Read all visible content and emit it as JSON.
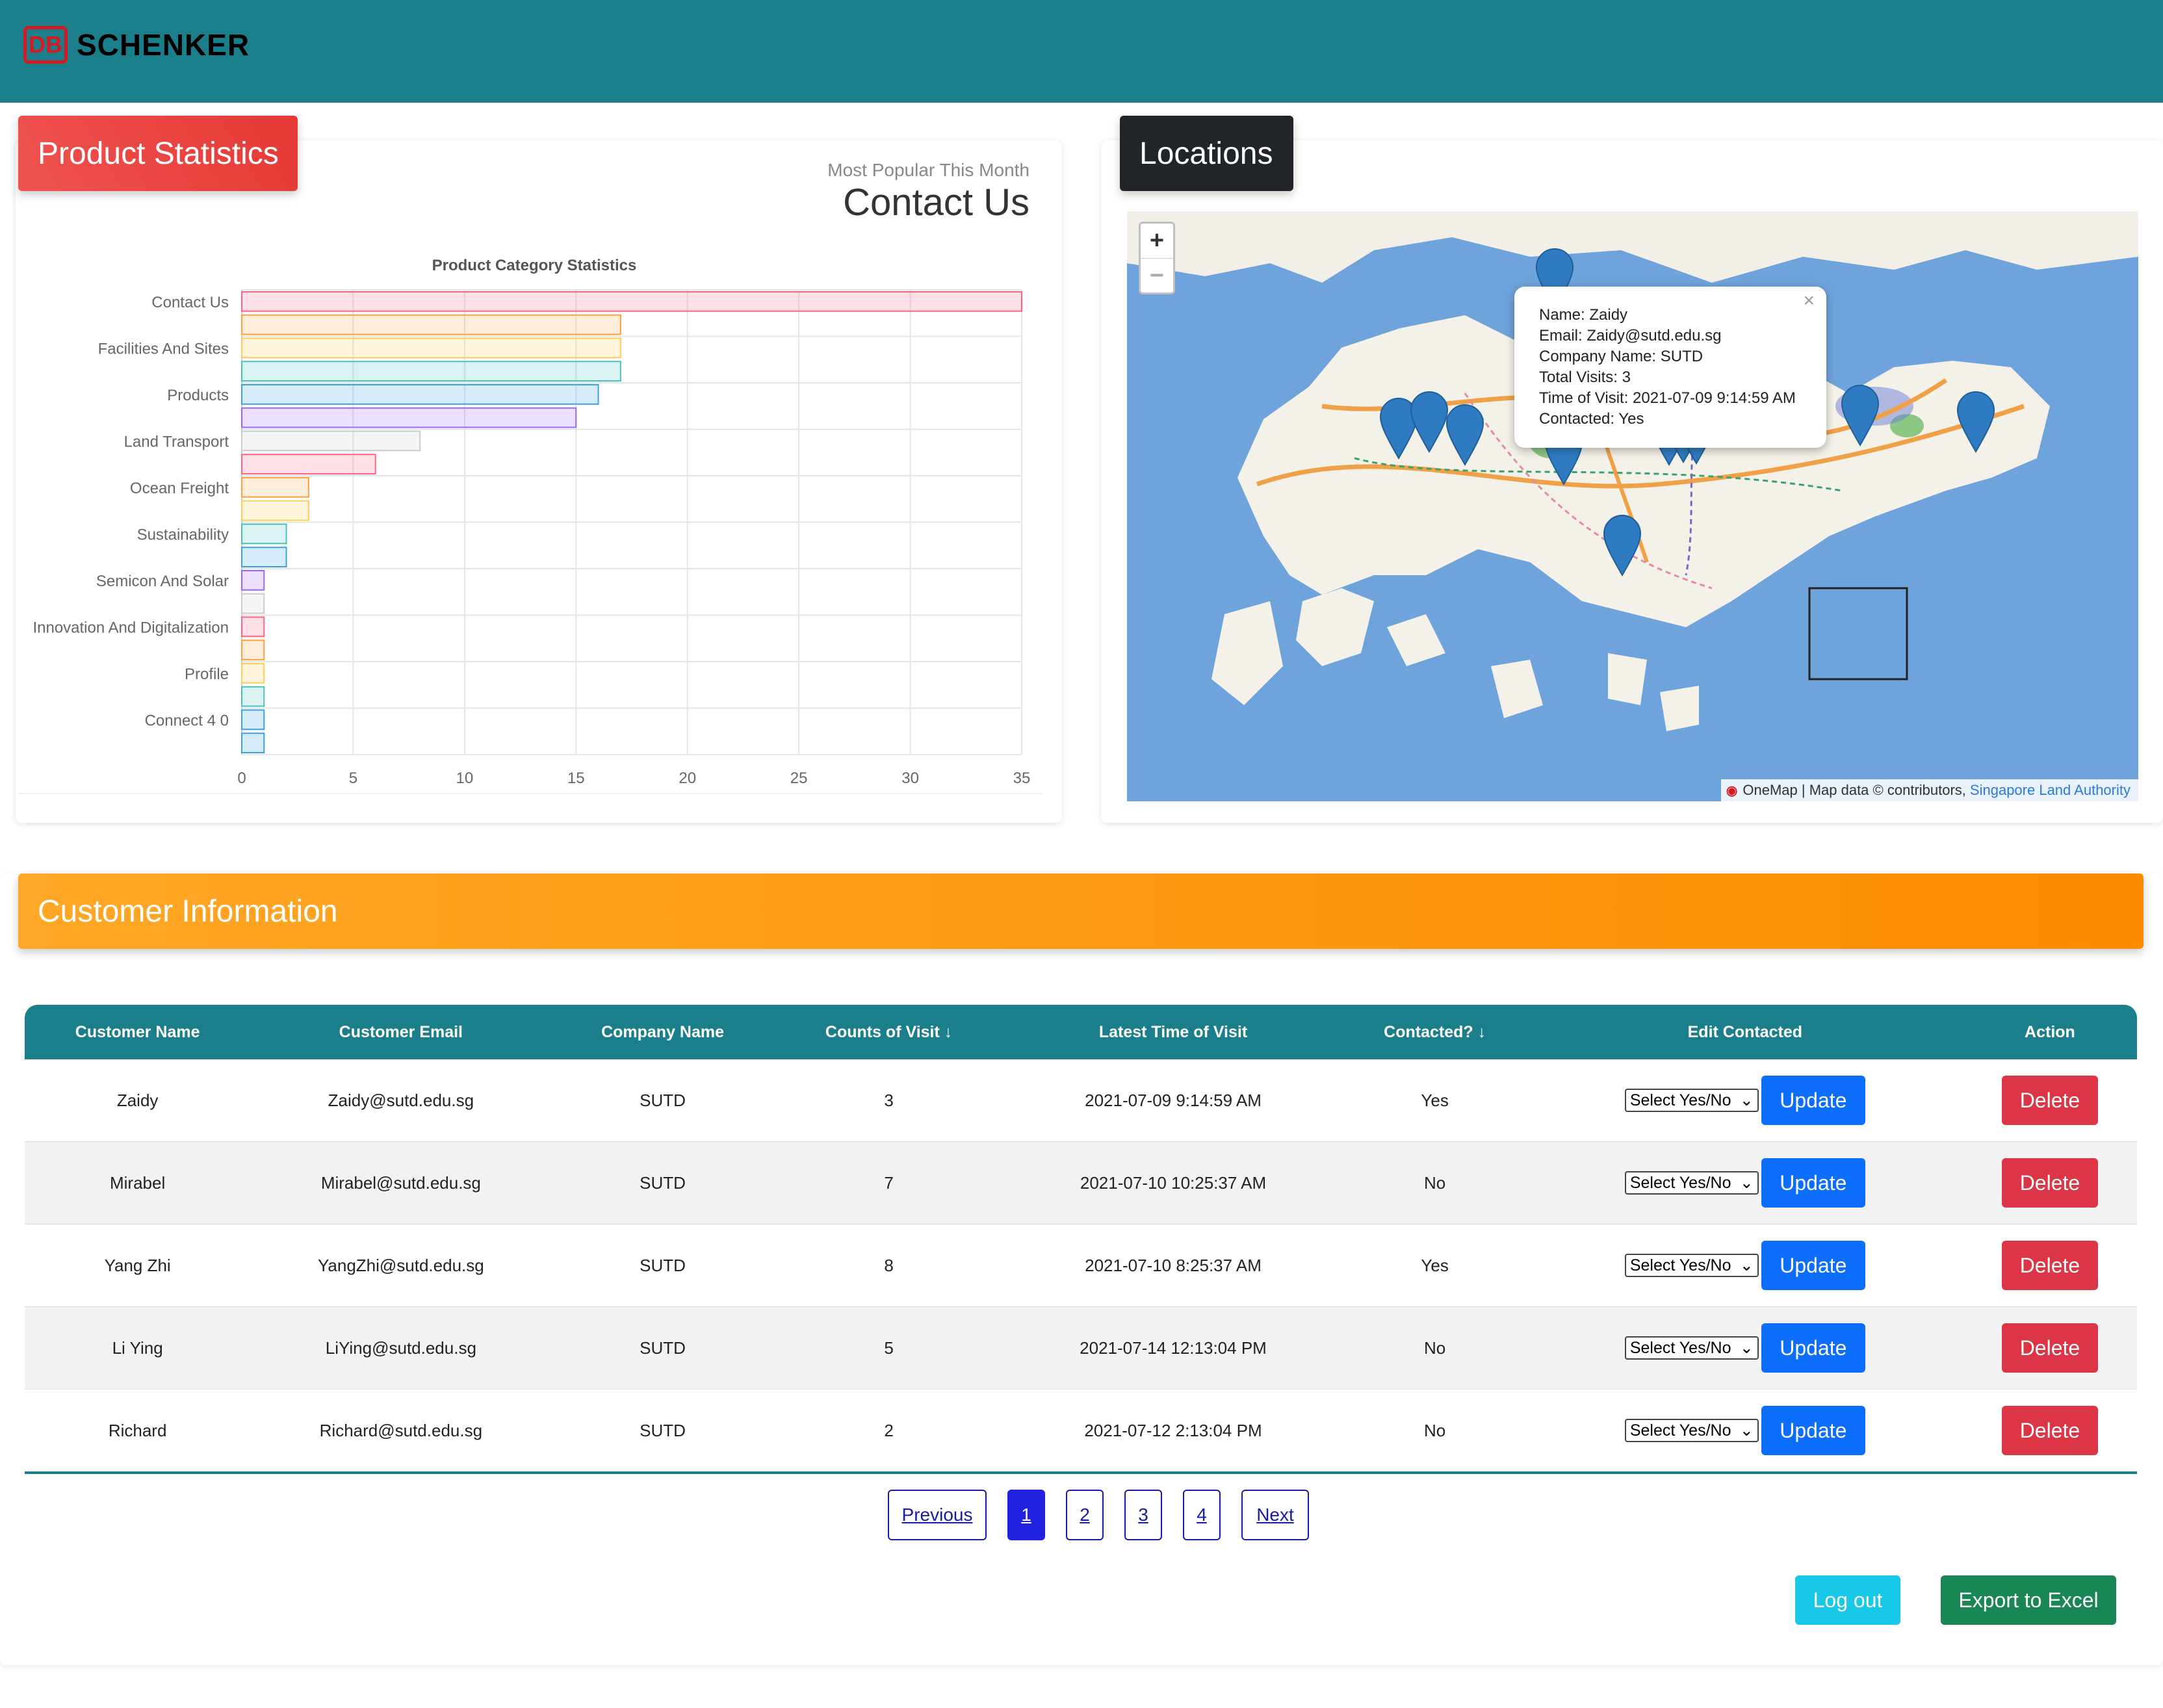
{
  "brand": {
    "db": "DB",
    "name": "SCHENKER"
  },
  "product_statistics": {
    "badge": "Product Statistics",
    "popular_subtitle": "Most Popular This Month",
    "popular_title": "Contact Us"
  },
  "locations": {
    "badge": "Locations",
    "zoom_in": "+",
    "zoom_out": "−",
    "popup": {
      "close": "×",
      "line1": "Name: Zaidy",
      "line2": "Email: Zaidy@sutd.edu.sg",
      "line3": "Company Name: SUTD",
      "line4": "Total Visits: 3",
      "line5": "Time of Visit: 2021-07-09 9:14:59 AM",
      "line6": "Contacted: Yes"
    },
    "attribution": {
      "logo": "One map",
      "text": "OneMap | Map data © contributors,",
      "link": "Singapore Land Authority"
    }
  },
  "chart_data": {
    "type": "bar",
    "orientation": "horizontal",
    "title": "Product Category Statistics",
    "categories": [
      "Contact Us",
      "",
      "Facilities And Sites",
      "",
      "Products",
      "",
      "Land Transport",
      "",
      "Ocean Freight",
      "",
      "Sustainability",
      "",
      "Semicon And Solar",
      "",
      "Innovation And Digitalization",
      "",
      "Profile",
      "",
      "Connect 4 0",
      ""
    ],
    "values": [
      35,
      17,
      17,
      17,
      16,
      15,
      8,
      6,
      3,
      3,
      2,
      2,
      1,
      1,
      1,
      1,
      1,
      1,
      1,
      1
    ],
    "colors": [
      "#ff6384",
      "#ff9f40",
      "#ffcd56",
      "#4bc0c0",
      "#36a2eb",
      "#9966ff",
      "#c9cbcf",
      "#ff6384",
      "#ff9f40",
      "#ffcd56",
      "#4bc0c0",
      "#36a2eb",
      "#9966ff",
      "#c9cbcf",
      "#ff6384",
      "#ff9f40",
      "#ffcd56",
      "#4bc0c0",
      "#36a2eb",
      "#36a2eb"
    ],
    "xlim": [
      0,
      35
    ],
    "xticks": [
      0,
      5,
      10,
      15,
      20,
      25,
      30,
      35
    ],
    "grid": true
  },
  "customer": {
    "badge": "Customer Information",
    "headers": [
      "Customer Name",
      "Customer Email",
      "Company Name",
      "Counts of Visit ↓",
      "Latest Time of Visit",
      "Contacted? ↓",
      "Edit Contacted",
      "Action"
    ],
    "select_label": "Select Yes/No",
    "update_label": "Update",
    "delete_label": "Delete",
    "rows": [
      {
        "name": "Zaidy",
        "email": "Zaidy@sutd.edu.sg",
        "company": "SUTD",
        "visits": "3",
        "time": "2021-07-09 9:14:59 AM",
        "contacted": "Yes"
      },
      {
        "name": "Mirabel",
        "email": "Mirabel@sutd.edu.sg",
        "company": "SUTD",
        "visits": "7",
        "time": "2021-07-10 10:25:37 AM",
        "contacted": "No"
      },
      {
        "name": "Yang Zhi",
        "email": "YangZhi@sutd.edu.sg",
        "company": "SUTD",
        "visits": "8",
        "time": "2021-07-10 8:25:37 AM",
        "contacted": "Yes"
      },
      {
        "name": "Li Ying",
        "email": "LiYing@sutd.edu.sg",
        "company": "SUTD",
        "visits": "5",
        "time": "2021-07-14 12:13:04 PM",
        "contacted": "No"
      },
      {
        "name": "Richard",
        "email": "Richard@sutd.edu.sg",
        "company": "SUTD",
        "visits": "2",
        "time": "2021-07-12 2:13:04 PM",
        "contacted": "No"
      }
    ]
  },
  "pagination": {
    "previous": "Previous",
    "pages": [
      "1",
      "2",
      "3",
      "4"
    ],
    "next": "Next",
    "active": "1"
  },
  "actions": {
    "logout": "Log out",
    "export": "Export to Excel"
  }
}
